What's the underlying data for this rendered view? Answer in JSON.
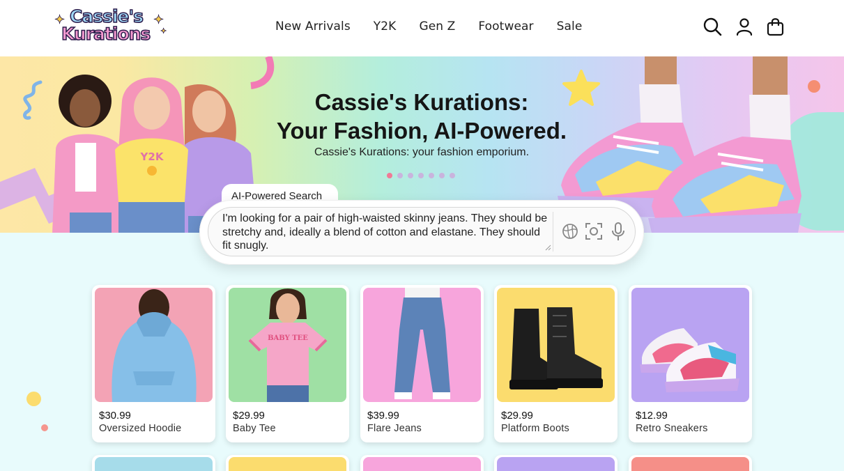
{
  "brand": {
    "line1": "Cassie's",
    "line2": "Kurations"
  },
  "nav": [
    "New Arrivals",
    "Y2K",
    "Gen Z",
    "Footwear",
    "Sale"
  ],
  "header_icons": [
    "search-icon",
    "user-icon",
    "shopping-bag-icon"
  ],
  "hero": {
    "title_line1": "Cassie's Kurations:",
    "title_line2": "Your Fashion, AI-Powered.",
    "subtitle": "Cassie's Kurations: your fashion emporium.",
    "carousel": {
      "total": 7,
      "active": 0
    },
    "shirt_text": "Y2K"
  },
  "search": {
    "tab_label": "AI-Powered Search",
    "value": "I'm looking for a pair of high-waisted skinny jeans. They should be stretchy and, ideally a blend of cotton and elastane. They should fit snugly.",
    "icons": [
      "image-search-icon",
      "camera-scan-icon",
      "microphone-icon"
    ]
  },
  "products": [
    {
      "price": "$30.99",
      "name": "Oversized Hoodie",
      "bg": "#f3a3b5"
    },
    {
      "price": "$29.99",
      "name": "Baby Tee",
      "bg": "#9fe0a4",
      "print": "BABY TEE"
    },
    {
      "price": "$39.99",
      "name": "Flare Jeans",
      "bg": "#f7a5dc"
    },
    {
      "price": "$29.99",
      "name": "Platform Boots",
      "bg": "#fbdc6e"
    },
    {
      "price": "$12.99",
      "name": "Retro Sneakers",
      "bg": "#b9a3f2"
    }
  ],
  "next_row_colors": [
    "#a6dcea",
    "#fbdc6e",
    "#f7a5dc",
    "#b9a3f2",
    "#f58f88"
  ],
  "colors": {
    "accent_pink": "#f07a96",
    "page_bg": "#e8fbfc"
  }
}
